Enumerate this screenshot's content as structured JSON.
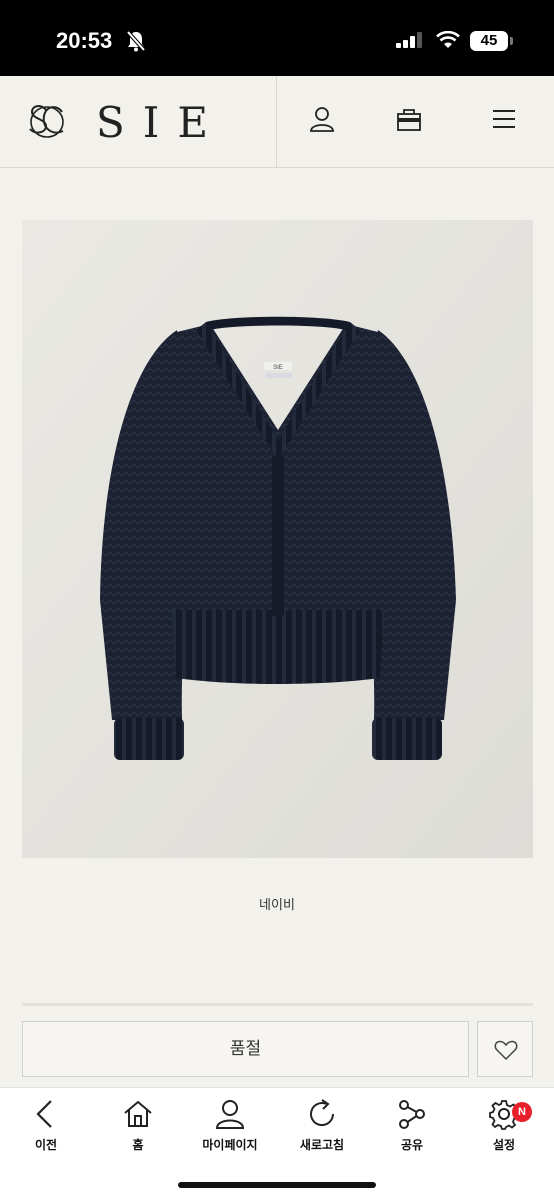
{
  "status_bar": {
    "time": "20:53",
    "battery": "45"
  },
  "header": {
    "brand": "SIE"
  },
  "product": {
    "variant": "네이비",
    "soldout_label": "품절",
    "label_tag": "SIE"
  },
  "bottom_nav": {
    "items": [
      {
        "label": "이전",
        "icon": "back-chevron-icon"
      },
      {
        "label": "홈",
        "icon": "home-icon"
      },
      {
        "label": "마이페이지",
        "icon": "person-icon"
      },
      {
        "label": "새로고침",
        "icon": "refresh-icon"
      },
      {
        "label": "공유",
        "icon": "share-icon"
      },
      {
        "label": "설정",
        "icon": "gear-icon",
        "badge": "N"
      }
    ]
  },
  "colors": {
    "background": "#f2f1ec",
    "sweater": "#1c2232",
    "badge": "#e8202a"
  }
}
